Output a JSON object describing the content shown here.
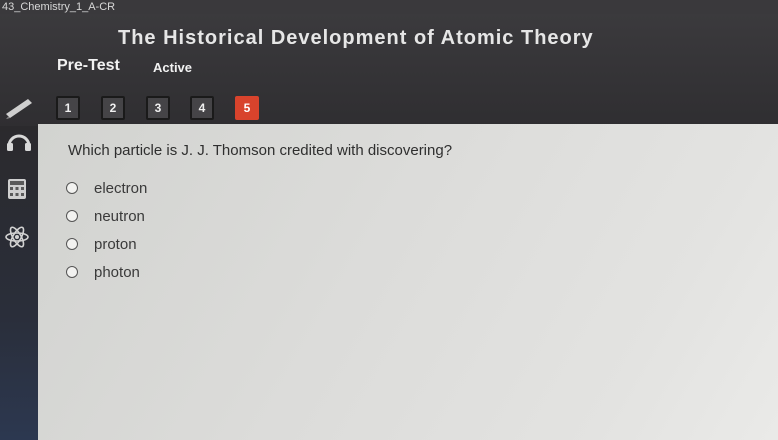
{
  "window": {
    "tab_title": "43_Chemistry_1_A-CR"
  },
  "header": {
    "title": "The Historical Development of Atomic Theory",
    "mode": "Pre-Test",
    "status": "Active"
  },
  "question_nav": {
    "items": [
      "1",
      "2",
      "3",
      "4",
      "5"
    ],
    "current": "5"
  },
  "sidebar": {
    "icons": [
      "headphones-icon",
      "calculator-icon",
      "atom-icon"
    ]
  },
  "question": {
    "text": "Which particle is J. J. Thomson credited with discovering?",
    "options": [
      "electron",
      "neutron",
      "proton",
      "photon"
    ]
  },
  "colors": {
    "accent": "#d8432c",
    "header_bg": "#343336",
    "content_bg": "#dcdcda"
  }
}
